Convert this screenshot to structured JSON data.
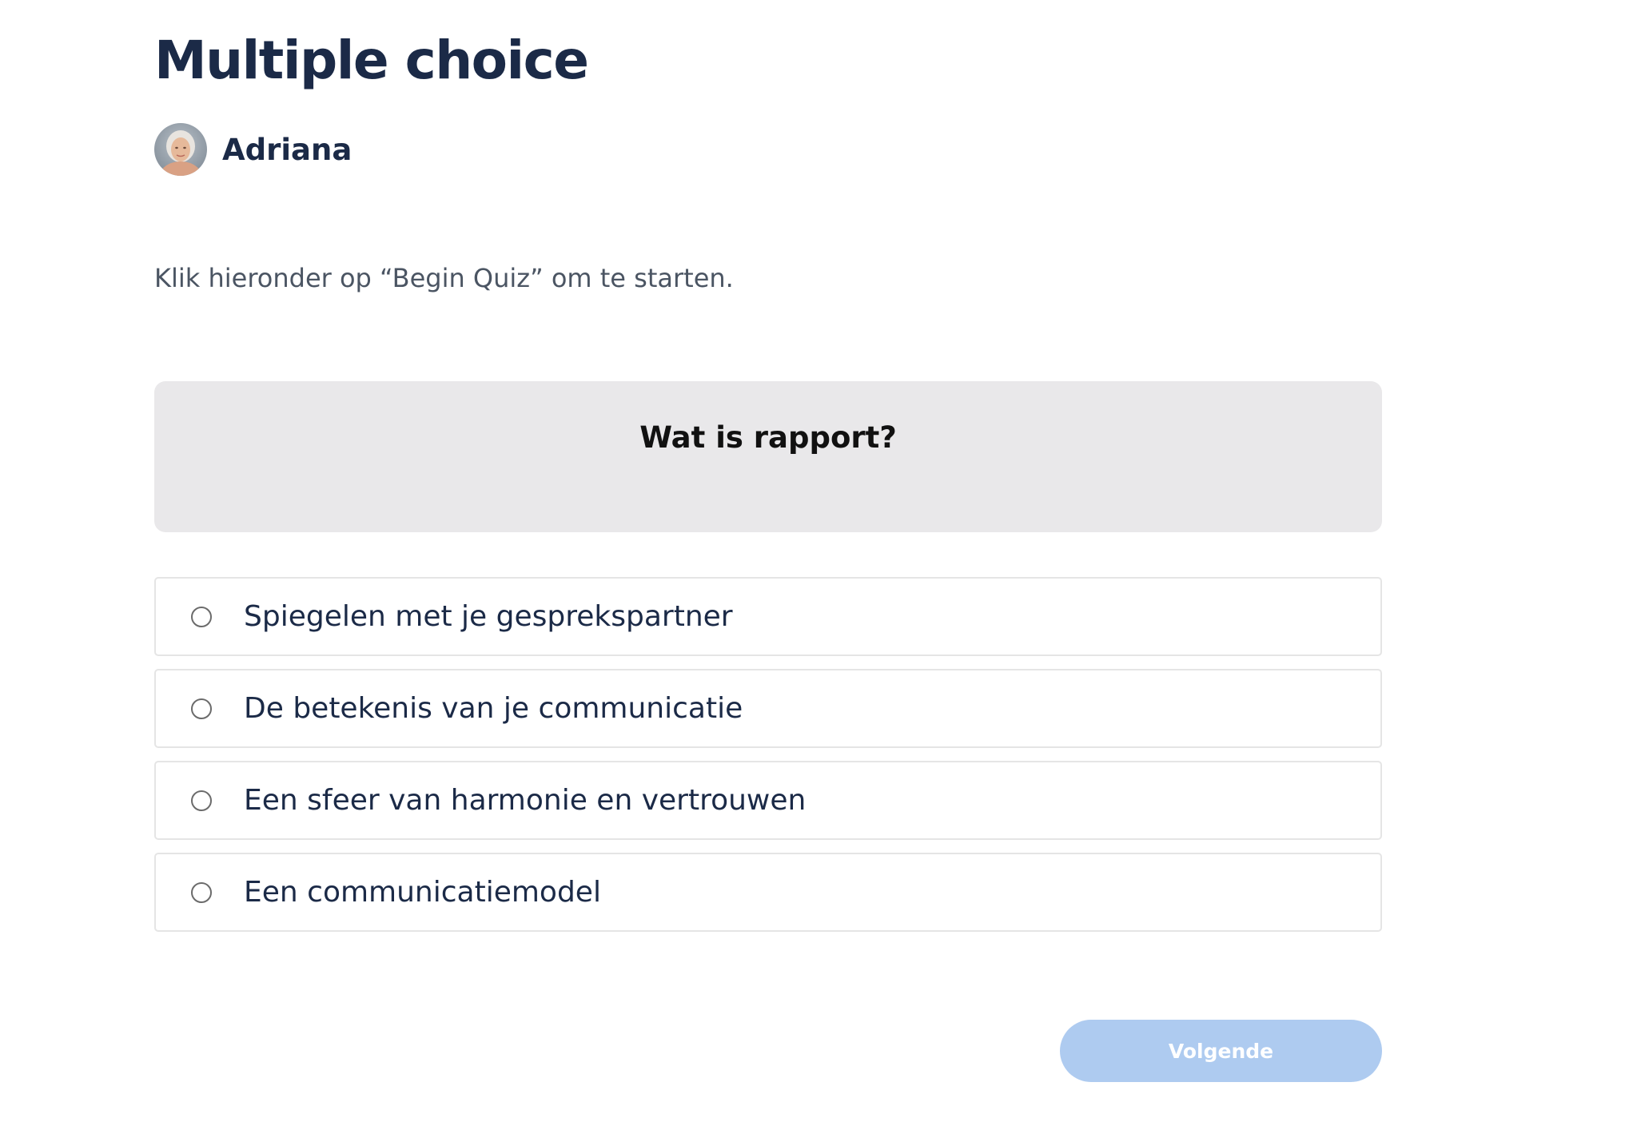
{
  "page": {
    "title": "Multiple choice",
    "author": {
      "name": "Adriana",
      "avatar_icon": "user-avatar-photo"
    },
    "intro": "Klik hieronder op “Begin Quiz” om te starten."
  },
  "quiz": {
    "question": "Wat is rapport?",
    "options": [
      {
        "label": "Spiegelen met je gesprekspartner",
        "selected": false
      },
      {
        "label": "De betekenis van je communicatie",
        "selected": false
      },
      {
        "label": "Een sfeer van harmonie en vertrouwen",
        "selected": false
      },
      {
        "label": "Een communicatiemodel",
        "selected": false
      }
    ],
    "next_button": {
      "label": "Volgende",
      "enabled": false
    }
  },
  "colors": {
    "heading": "#1b2a47",
    "question_background": "#e9e8ea",
    "button_disabled": "#aecbf0"
  }
}
